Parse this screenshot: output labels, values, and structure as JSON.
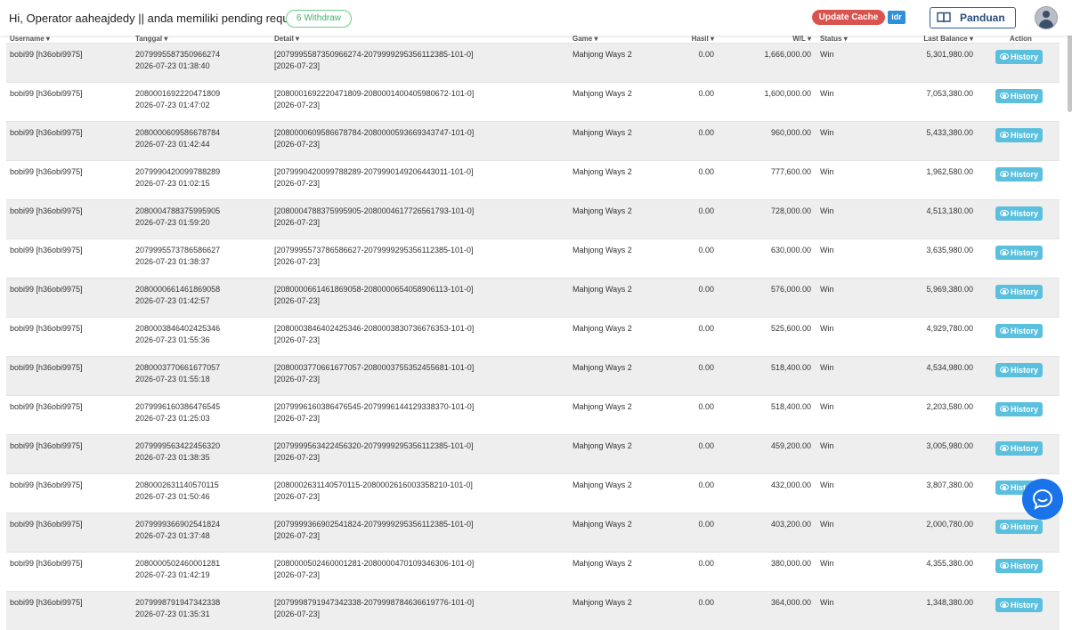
{
  "header": {
    "greeting": "Hi, Operator aaheajdedy || anda memiliki pending request:",
    "withdraw_badge": "6 Withdraw",
    "update_cache": "Update Cache",
    "currency": "idr",
    "panduan": "Panduan"
  },
  "table": {
    "columns": [
      "Username",
      "Tanggal",
      "Detail",
      "Game",
      "Hasil",
      "W/L",
      "Status",
      "Last Balance",
      "Action"
    ],
    "history_label": "History",
    "rows": [
      {
        "username": "bobi99 [h36obi9975]",
        "id": "2079995587350966274",
        "time": "2026-07-23 01:38:40",
        "detail": "[2079995587350966274-2079999295356112385-101-0]",
        "detail_date": "[2026-07-23]",
        "game": "Mahjong Ways 2",
        "hasil": "0.00",
        "wl": "1,666,000.00",
        "status": "Win",
        "balance": "5,301,980.00"
      },
      {
        "username": "bobi99 [h36obi9975]",
        "id": "2080001692220471809",
        "time": "2026-07-23 01:47:02",
        "detail": "[2080001692220471809-2080001400405980672-101-0]",
        "detail_date": "[2026-07-23]",
        "game": "Mahjong Ways 2",
        "hasil": "0.00",
        "wl": "1,600,000.00",
        "status": "Win",
        "balance": "7,053,380.00"
      },
      {
        "username": "bobi99 [h36obi9975]",
        "id": "2080000609586678784",
        "time": "2026-07-23 01:42:44",
        "detail": "[2080000609586678784-2080000593669343747-101-0]",
        "detail_date": "[2026-07-23]",
        "game": "Mahjong Ways 2",
        "hasil": "0.00",
        "wl": "960,000.00",
        "status": "Win",
        "balance": "5,433,380.00"
      },
      {
        "username": "bobi99 [h36obi9975]",
        "id": "2079990420099788289",
        "time": "2026-07-23 01:02:15",
        "detail": "[2079990420099788289-2079990149206443011-101-0]",
        "detail_date": "[2026-07-23]",
        "game": "Mahjong Ways 2",
        "hasil": "0.00",
        "wl": "777,600.00",
        "status": "Win",
        "balance": "1,962,580.00"
      },
      {
        "username": "bobi99 [h36obi9975]",
        "id": "2080004788375995905",
        "time": "2026-07-23 01:59:20",
        "detail": "[2080004788375995905-2080004617726561793-101-0]",
        "detail_date": "[2026-07-23]",
        "game": "Mahjong Ways 2",
        "hasil": "0.00",
        "wl": "728,000.00",
        "status": "Win",
        "balance": "4,513,180.00"
      },
      {
        "username": "bobi99 [h36obi9975]",
        "id": "2079995573786586627",
        "time": "2026-07-23 01:38:37",
        "detail": "[2079995573786586627-2079999295356112385-101-0]",
        "detail_date": "[2026-07-23]",
        "game": "Mahjong Ways 2",
        "hasil": "0.00",
        "wl": "630,000.00",
        "status": "Win",
        "balance": "3,635,980.00"
      },
      {
        "username": "bobi99 [h36obi9975]",
        "id": "2080000661461869058",
        "time": "2026-07-23 01:42:57",
        "detail": "[2080000661461869058-2080000654058906113-101-0]",
        "detail_date": "[2026-07-23]",
        "game": "Mahjong Ways 2",
        "hasil": "0.00",
        "wl": "576,000.00",
        "status": "Win",
        "balance": "5,969,380.00"
      },
      {
        "username": "bobi99 [h36obi9975]",
        "id": "2080003846402425346",
        "time": "2026-07-23 01:55:36",
        "detail": "[2080003846402425346-2080003830736676353-101-0]",
        "detail_date": "[2026-07-23]",
        "game": "Mahjong Ways 2",
        "hasil": "0.00",
        "wl": "525,600.00",
        "status": "Win",
        "balance": "4,929,780.00"
      },
      {
        "username": "bobi99 [h36obi9975]",
        "id": "2080003770661677057",
        "time": "2026-07-23 01:55:18",
        "detail": "[2080003770661677057-2080003755352455681-101-0]",
        "detail_date": "[2026-07-23]",
        "game": "Mahjong Ways 2",
        "hasil": "0.00",
        "wl": "518,400.00",
        "status": "Win",
        "balance": "4,534,980.00"
      },
      {
        "username": "bobi99 [h36obi9975]",
        "id": "2079996160386476545",
        "time": "2026-07-23 01:25:03",
        "detail": "[2079996160386476545-2079996144129338370-101-0]",
        "detail_date": "[2026-07-23]",
        "game": "Mahjong Ways 2",
        "hasil": "0.00",
        "wl": "518,400.00",
        "status": "Win",
        "balance": "2,203,580.00"
      },
      {
        "username": "bobi99 [h36obi9975]",
        "id": "2079999563422456320",
        "time": "2026-07-23 01:38:35",
        "detail": "[2079999563422456320-2079999295356112385-101-0]",
        "detail_date": "[2026-07-23]",
        "game": "Mahjong Ways 2",
        "hasil": "0.00",
        "wl": "459,200.00",
        "status": "Win",
        "balance": "3,005,980.00"
      },
      {
        "username": "bobi99 [h36obi9975]",
        "id": "2080002631140570115",
        "time": "2026-07-23 01:50:46",
        "detail": "[2080002631140570115-2080002616003358210-101-0]",
        "detail_date": "[2026-07-23]",
        "game": "Mahjong Ways 2",
        "hasil": "0.00",
        "wl": "432,000.00",
        "status": "Win",
        "balance": "3,807,380.00"
      },
      {
        "username": "bobi99 [h36obi9975]",
        "id": "2079999366902541824",
        "time": "2026-07-23 01:37:48",
        "detail": "[2079999366902541824-2079999295356112385-101-0]",
        "detail_date": "[2026-07-23]",
        "game": "Mahjong Ways 2",
        "hasil": "0.00",
        "wl": "403,200.00",
        "status": "Win",
        "balance": "2,000,780.00"
      },
      {
        "username": "bobi99 [h36obi9975]",
        "id": "2080000502460001281",
        "time": "2026-07-23 01:42:19",
        "detail": "[2080000502460001281-2080000470109346306-101-0]",
        "detail_date": "[2026-07-23]",
        "game": "Mahjong Ways 2",
        "hasil": "0.00",
        "wl": "380,000.00",
        "status": "Win",
        "balance": "4,355,380.00"
      },
      {
        "username": "bobi99 [h36obi9975]",
        "id": "2079998791947342338",
        "time": "2026-07-23 01:35:31",
        "detail": "[2079998791947342338-2079998784636619776-101-0]",
        "detail_date": "[2026-07-23]",
        "game": "Mahjong Ways 2",
        "hasil": "0.00",
        "wl": "364,000.00",
        "status": "Win",
        "balance": "1,348,380.00"
      }
    ]
  }
}
